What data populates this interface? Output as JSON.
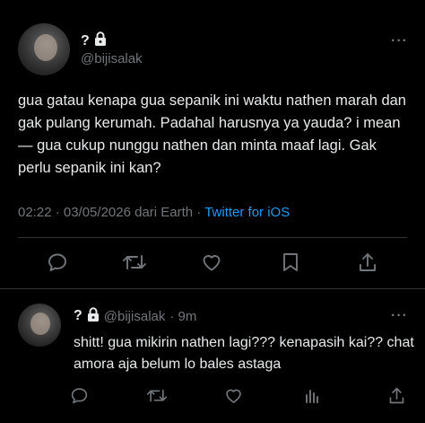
{
  "tweet": {
    "name": "?",
    "handle": "@bijisalak",
    "text": "gua gatau kenapa gua sepanik ini waktu nathen marah dan gak pulang kerumah. Padahal harusnya ya yauda? i mean— gua cukup nunggu nathen dan minta maaf lagi. Gak perlu sepanik ini kan?",
    "time": "02:22 · 03/05/2026 dari Earth · ",
    "source_app": "Twitter for iOS",
    "more_label": "···"
  },
  "reply": {
    "name": "?",
    "handle": "@bijisalak",
    "age": "· 9m",
    "text": "shitt! gua mikirin nathen lagi??? kenapasih kai?? chat amora aja belum lo bales astaga",
    "more_label": "···"
  },
  "icons": {
    "protected": "lock-icon",
    "reply": "reply-icon",
    "retweet": "retweet-icon",
    "like": "heart-icon",
    "bookmark": "bookmark-icon",
    "share": "share-icon",
    "analytics": "analytics-icon"
  },
  "colors": {
    "background": "#000000",
    "text": "#e7e9ea",
    "secondary": "#71767b",
    "link": "#1d9bf0",
    "divider": "#2f3336"
  }
}
